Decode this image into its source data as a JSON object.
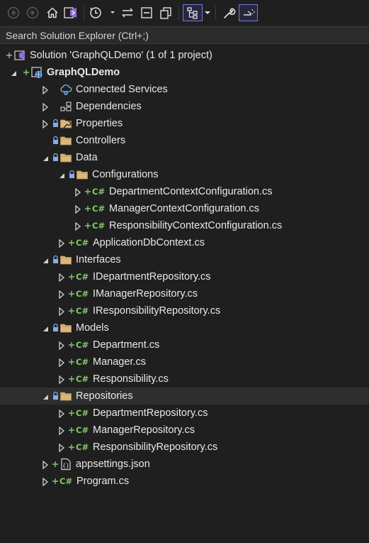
{
  "toolbar": {
    "buttons": [
      {
        "name": "back-button",
        "icon": "arrow-left-circle-icon"
      },
      {
        "name": "forward-button",
        "icon": "arrow-right-circle-icon"
      },
      {
        "name": "home-button",
        "icon": "home-icon"
      },
      {
        "name": "switch-views-button",
        "icon": "vs-switch-icon"
      },
      {
        "name": "pending-changes-filter-button",
        "icon": "clock-icon"
      },
      {
        "name": "sync-active-document-button",
        "icon": "sync-arrows-icon"
      },
      {
        "name": "collapse-all-button",
        "icon": "collapse-all-icon"
      },
      {
        "name": "show-all-files-button",
        "icon": "copy-files-icon"
      },
      {
        "name": "view-hierarchy-button",
        "icon": "hierarchy-icon"
      },
      {
        "name": "properties-button",
        "icon": "wrench-icon"
      },
      {
        "name": "preview-selected-items-button",
        "icon": "preview-icon"
      }
    ]
  },
  "search": {
    "placeholder": "Search Solution Explorer (Ctrl+;)"
  },
  "tree": [
    {
      "label": "Solution 'GraphQLDemo' (1 of 1 project)",
      "type": "solution",
      "indent": 0
    },
    {
      "label": "GraphQLDemo",
      "type": "project",
      "indent": 1,
      "expanded": true
    },
    {
      "label": "Connected Services",
      "type": "connected",
      "indent": 2,
      "expander": "collapsed"
    },
    {
      "label": "Dependencies",
      "type": "dependencies",
      "indent": 2,
      "expander": "collapsed"
    },
    {
      "label": "Properties",
      "type": "properties",
      "indent": 2,
      "expander": "collapsed",
      "lock": true
    },
    {
      "label": "Controllers",
      "type": "folder",
      "indent": 2,
      "lock": true
    },
    {
      "label": "Data",
      "type": "folder",
      "indent": 2,
      "expander": "expanded",
      "lock": true
    },
    {
      "label": "Configurations",
      "type": "folder",
      "indent": 3,
      "expander": "expanded",
      "lock": true
    },
    {
      "label": "DepartmentContextConfiguration.cs",
      "type": "cs",
      "indent": 4,
      "expander": "collapsed"
    },
    {
      "label": "ManagerContextConfiguration.cs",
      "type": "cs",
      "indent": 4,
      "expander": "collapsed"
    },
    {
      "label": "ResponsibilityContextConfiguration.cs",
      "type": "cs",
      "indent": 4,
      "expander": "collapsed"
    },
    {
      "label": "ApplicationDbContext.cs",
      "type": "cs",
      "indent": 3,
      "expander": "collapsed"
    },
    {
      "label": "Interfaces",
      "type": "folder",
      "indent": 2,
      "expander": "expanded",
      "lock": true
    },
    {
      "label": "IDepartmentRepository.cs",
      "type": "cs",
      "indent": 3,
      "expander": "collapsed"
    },
    {
      "label": "IManagerRepository.cs",
      "type": "cs",
      "indent": 3,
      "expander": "collapsed"
    },
    {
      "label": "IResponsibilityRepository.cs",
      "type": "cs",
      "indent": 3,
      "expander": "collapsed"
    },
    {
      "label": "Models",
      "type": "folder",
      "indent": 2,
      "expander": "expanded",
      "lock": true
    },
    {
      "label": "Department.cs",
      "type": "cs",
      "indent": 3,
      "expander": "collapsed"
    },
    {
      "label": "Manager.cs",
      "type": "cs",
      "indent": 3,
      "expander": "collapsed"
    },
    {
      "label": "Responsibility.cs",
      "type": "cs",
      "indent": 3,
      "expander": "collapsed"
    },
    {
      "label": "Repositories",
      "type": "folder",
      "indent": 2,
      "expander": "expanded",
      "lock": true,
      "selected": true
    },
    {
      "label": "DepartmentRepository.cs",
      "type": "cs",
      "indent": 3,
      "expander": "collapsed"
    },
    {
      "label": "ManagerRepository.cs",
      "type": "cs",
      "indent": 3,
      "expander": "collapsed"
    },
    {
      "label": "ResponsibilityRepository.cs",
      "type": "cs",
      "indent": 3,
      "expander": "collapsed"
    },
    {
      "label": "appsettings.json",
      "type": "json",
      "indent": 2,
      "expander": "collapsed"
    },
    {
      "label": "Program.cs",
      "type": "cs",
      "indent": 2,
      "expander": "collapsed"
    }
  ],
  "file_type_badge": "C#",
  "colors": {
    "background": "#1f1f1f",
    "folder": "#dcb67a",
    "csharp": "#86c96a",
    "lock": "#7fb0e8",
    "selected_row": "#2e2e2e",
    "toolbar_active_border": "#7a78d6"
  }
}
